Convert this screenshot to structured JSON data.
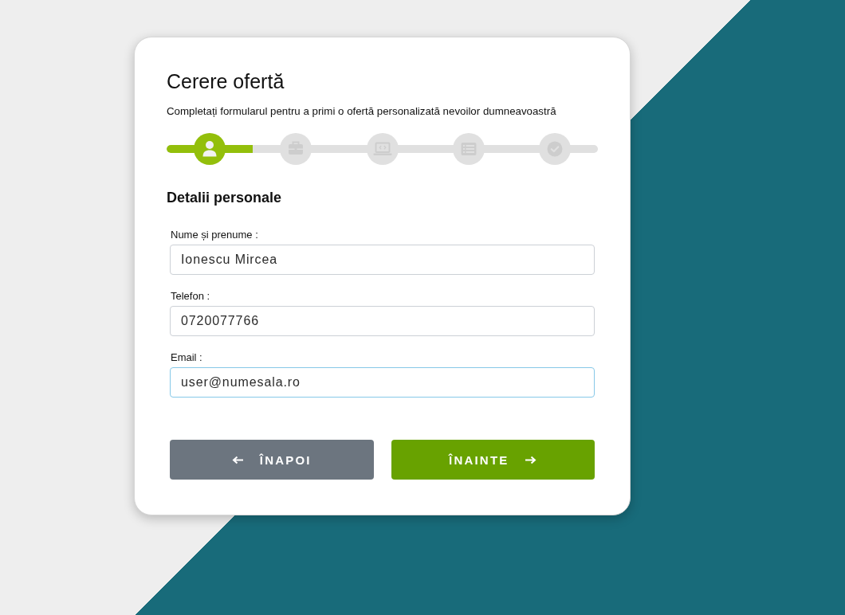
{
  "form": {
    "title": "Cerere ofertă",
    "subtitle": "Completați formularul pentru a primi o ofertă personalizată nevoilor dumneavoastră",
    "stepper": {
      "level": 0.2,
      "steps": [
        {
          "selected": true
        },
        {
          "selected": false
        },
        {
          "selected": false
        },
        {
          "selected": false
        },
        {
          "selected": false
        }
      ]
    },
    "section_title": "Detalii personale",
    "fields": [
      {
        "label": "Nume și prenume :",
        "value": "Ionescu Mircea",
        "focused": false
      },
      {
        "label": "Telefon :",
        "value": "0720077766",
        "focused": false
      },
      {
        "label": "Email :",
        "value": "user@numesala.ro",
        "focused": true
      }
    ],
    "buttons": [
      {
        "kind": "back",
        "label": "ÎNAPOI"
      },
      {
        "kind": "next",
        "label": "ÎNAINTE"
      }
    ]
  }
}
